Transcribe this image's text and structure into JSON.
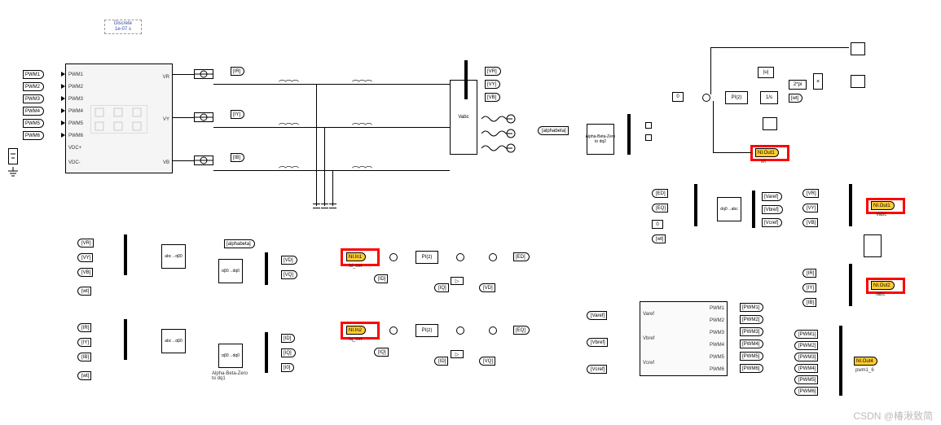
{
  "solver": {
    "line1": "Discrete",
    "line2": "1e-07 s"
  },
  "pwm_in": [
    "PWM1",
    "PWM2",
    "PWM3",
    "PWM4",
    "PWM5",
    "PWM6"
  ],
  "main_ports_left": [
    "PWM1",
    "PWM2",
    "PWM3",
    "PWM4",
    "PWM5",
    "PWM6",
    "VDC+",
    "VDC-"
  ],
  "main_ports_right": [
    "VR",
    "VY",
    "VB"
  ],
  "meas_tags": [
    "[IR]",
    "[IY]",
    "[IB]"
  ],
  "grid_tags_out": [
    "[VR]",
    "[VY]",
    "[VB]"
  ],
  "grid_label": "Vabc",
  "section_vabc": {
    "in_tags": [
      "[VR]",
      "[VY]",
      "[VB]",
      "[wt]"
    ],
    "xform1": "abc→αβ0",
    "out1": "[alphabeta]",
    "xform2": "αβ0→dq0",
    "out_tags": [
      "[VD]",
      "[VQ]"
    ]
  },
  "section_iabc": {
    "in_tags": [
      "[IR]",
      "[IY]",
      "[IB]",
      "[wt]"
    ],
    "xform1": "abc→αβ0",
    "xform2": "αβ0→dq0",
    "xform2_label": "Alpha-Beta-Zero\nto dq1",
    "out_tags": [
      "[ID]",
      "[IQ]",
      "[I0]"
    ]
  },
  "id_loop": {
    "ref_name": "NI.In1",
    "ref_label": "Id_set",
    "fb": "[ID]",
    "pi": "PI(z)",
    "decouple_in": "[IQ]",
    "ff": "[VD]",
    "out": "[ED]"
  },
  "iq_loop": {
    "ref_name": "NI.In2",
    "ref_label": "Iq_set",
    "fb": "[IQ]",
    "pi": "PI(z)",
    "decouple_in": "[ID]",
    "ff": "[VQ]",
    "out": "[EQ]"
  },
  "pll": {
    "in": "[alphabeta]",
    "xform": "Alpha-Beta-Zero\nto dq2",
    "zero": "0",
    "pi": "PI(z)",
    "integ": "1/s",
    "abs": "|u|",
    "gain": "2*pi",
    "wt_out": "[wt]",
    "ni_out_name": "NI.Out1",
    "ni_out_label": "wt"
  },
  "edq2abc": {
    "in": [
      "[ED]",
      "[EQ]",
      "0",
      "[wt]"
    ],
    "xform": "dq0→abc",
    "out": [
      "[Varef]",
      "[Vbref]",
      "[Vcref]"
    ]
  },
  "svpwm": {
    "in": [
      "[Varef]",
      "[Vbref]",
      "[Vcref]"
    ],
    "in_ports": [
      "Varef",
      "Vbref",
      "Vcref"
    ],
    "out_ports": [
      "PWM1",
      "PWM2",
      "PWM3",
      "PWM4",
      "PWM5",
      "PWM6"
    ],
    "out_tags": [
      "[PWM1]",
      "[PWM2]",
      "[PWM3]",
      "[PWM4]",
      "[PWM5]",
      "[PWM6]"
    ]
  },
  "scope_v": {
    "in": [
      "[VR]",
      "[VY]",
      "[VB]"
    ],
    "ni_out_name": "NI.Out1",
    "ni_out_label": "Vabc"
  },
  "scope_i": {
    "in": [
      "[IR]",
      "[IY]",
      "[IB]"
    ],
    "ni_out_name": "NI.Out2",
    "ni_out_label": "Iabc"
  },
  "pwm_ni": {
    "in": [
      "[PWM1]",
      "[PWM2]",
      "[PWM3]",
      "[PWM4]",
      "[PWM5]",
      "[PWM6]"
    ],
    "ni_out_name": "NI.Out4",
    "ni_out_label": "pwm1_6"
  },
  "watermark": "CSDN @椿湫致简"
}
